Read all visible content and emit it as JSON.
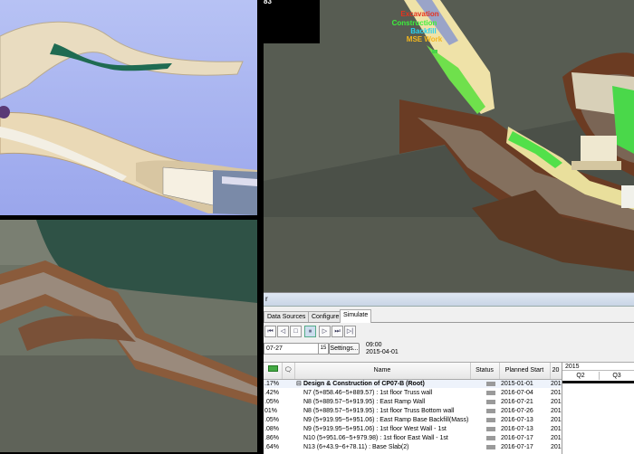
{
  "legend": {
    "partial_number": "83",
    "items": [
      {
        "label": "Excavation",
        "color": "#e6321e"
      },
      {
        "label": "Construction",
        "color": "#3cf03c"
      },
      {
        "label": "Backfill",
        "color": "#28d0f0"
      },
      {
        "label": "MSE Work",
        "color": "#f5b81e"
      }
    ]
  },
  "panel": {
    "title_fragment": "r",
    "tabs": [
      "Data Sources",
      "Configure",
      "Simulate"
    ],
    "active_tab": "Simulate",
    "date_value": "07-27",
    "settings_label": "Settings...",
    "time_label": "09:00",
    "date_label": "2015-04-01"
  },
  "grid": {
    "headers": {
      "name": "Name",
      "status": "Status",
      "planned_start": "Planned Start",
      "actual_fragment": "20"
    },
    "rows": [
      {
        "pct": ".17%",
        "expander": "⊟",
        "name": "Design & Construction of CP07-B (Root)",
        "start": "2015-01-01",
        "extra": "201",
        "bold": true
      },
      {
        "pct": ".42%",
        "expander": "",
        "name": "N7 (5+858.46~5+889.57) : 1st floor Truss wall",
        "start": "2016-07-04",
        "extra": "201",
        "bold": false
      },
      {
        "pct": ".05%",
        "expander": "",
        "name": "N8 (5+889.57~5+919.95) : East Ramp Wall",
        "start": "2016-07-21",
        "extra": "201",
        "bold": false
      },
      {
        "pct": "01%",
        "expander": "",
        "name": "N8 (5+889.57~5+919.95) : 1st floor Truss Bottom wall",
        "start": "2016-07-26",
        "extra": "201",
        "bold": false
      },
      {
        "pct": ".05%",
        "expander": "",
        "name": "N9 (5+919.95~5+951.06) : East Ramp Base Backfill(Mass)",
        "start": "2016-07-13",
        "extra": "201",
        "bold": false
      },
      {
        "pct": ".08%",
        "expander": "",
        "name": "N9 (5+919.95~5+951.06) : 1st floor West Wall - 1st",
        "start": "2016-07-13",
        "extra": "201",
        "bold": false
      },
      {
        "pct": ".86%",
        "expander": "",
        "name": "N10 (5+951.06~5+979.98) : 1st floor East Wall - 1st",
        "start": "2016-07-17",
        "extra": "201",
        "bold": false
      },
      {
        "pct": ".64%",
        "expander": "",
        "name": "N13 (6+43.9~6+78.11) : Base Slab(2)",
        "start": "2016-07-17",
        "extra": "201",
        "bold": false
      }
    ]
  },
  "gantt": {
    "year": "2015",
    "quarters": [
      "Q2",
      "Q3"
    ]
  },
  "toolbar_icons": [
    "rewind-icon",
    "step-back-icon",
    "stop-icon",
    "pause-icon",
    "play-icon",
    "step-forward-icon",
    "forward-icon"
  ]
}
